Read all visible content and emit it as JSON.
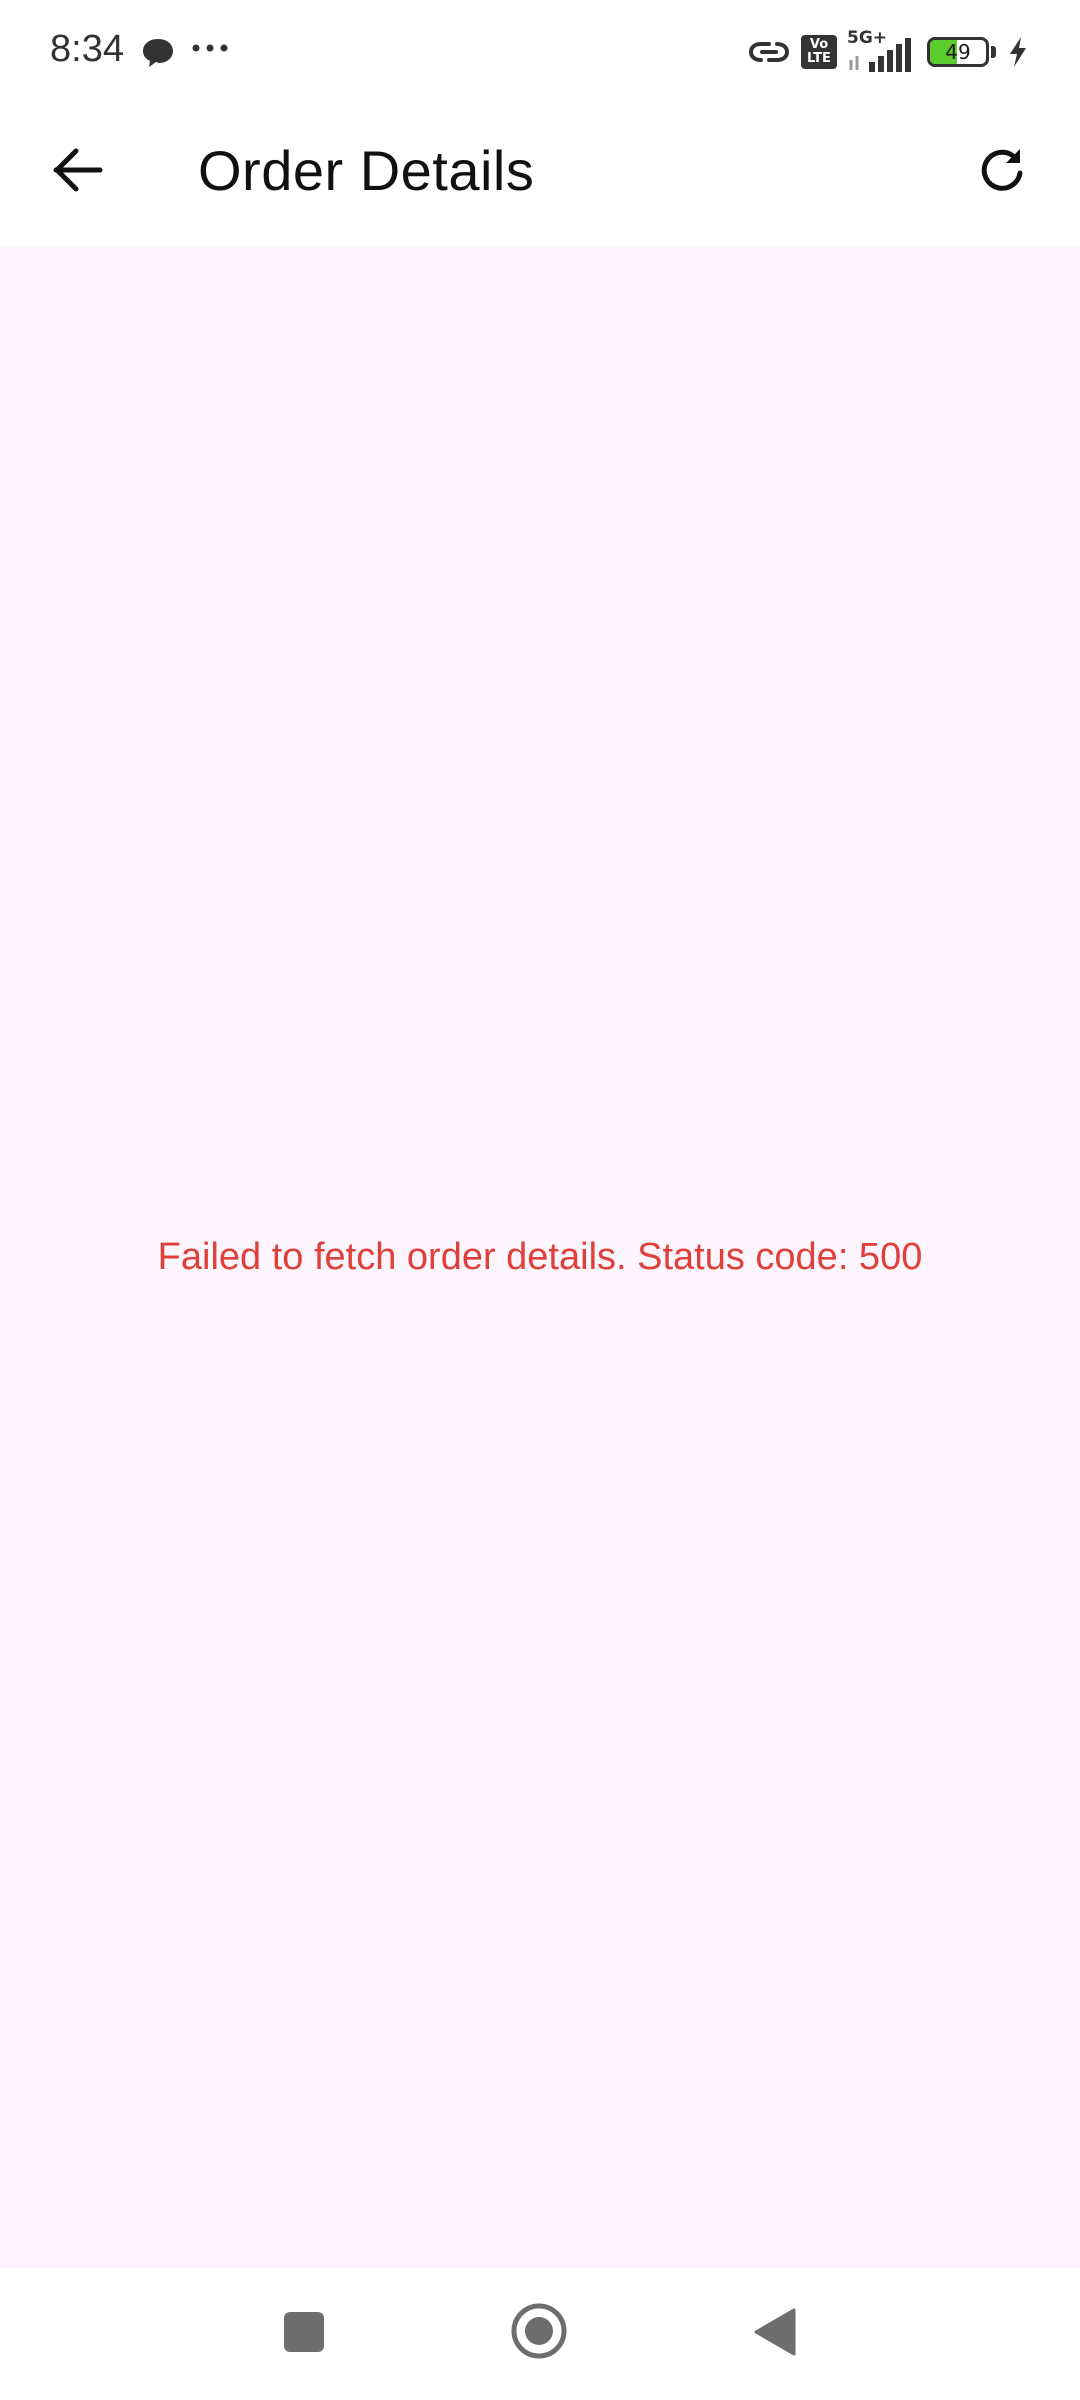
{
  "status_bar": {
    "time": "8:34",
    "network_type": "5G+",
    "volte_top": "Vo",
    "volte_bottom": "LTE",
    "battery_level": "49",
    "battery_fraction": 0.49,
    "icons": [
      "chat-bubble-icon",
      "more-dots-icon",
      "link-icon",
      "volte-icon",
      "signal-icon",
      "battery-icon",
      "charging-bolt-icon"
    ]
  },
  "app_bar": {
    "title": "Order Details",
    "back_icon": "arrow-left-icon",
    "refresh_icon": "refresh-icon"
  },
  "content": {
    "error_message": "Failed to fetch order details. Status code: 500"
  },
  "nav_bar": {
    "icons": [
      "recent-apps-icon",
      "home-icon",
      "back-triangle-icon"
    ]
  },
  "colors": {
    "content_background": "#fcf5fd",
    "error_text": "#e0403a",
    "battery_fill": "#5ccb2c"
  }
}
